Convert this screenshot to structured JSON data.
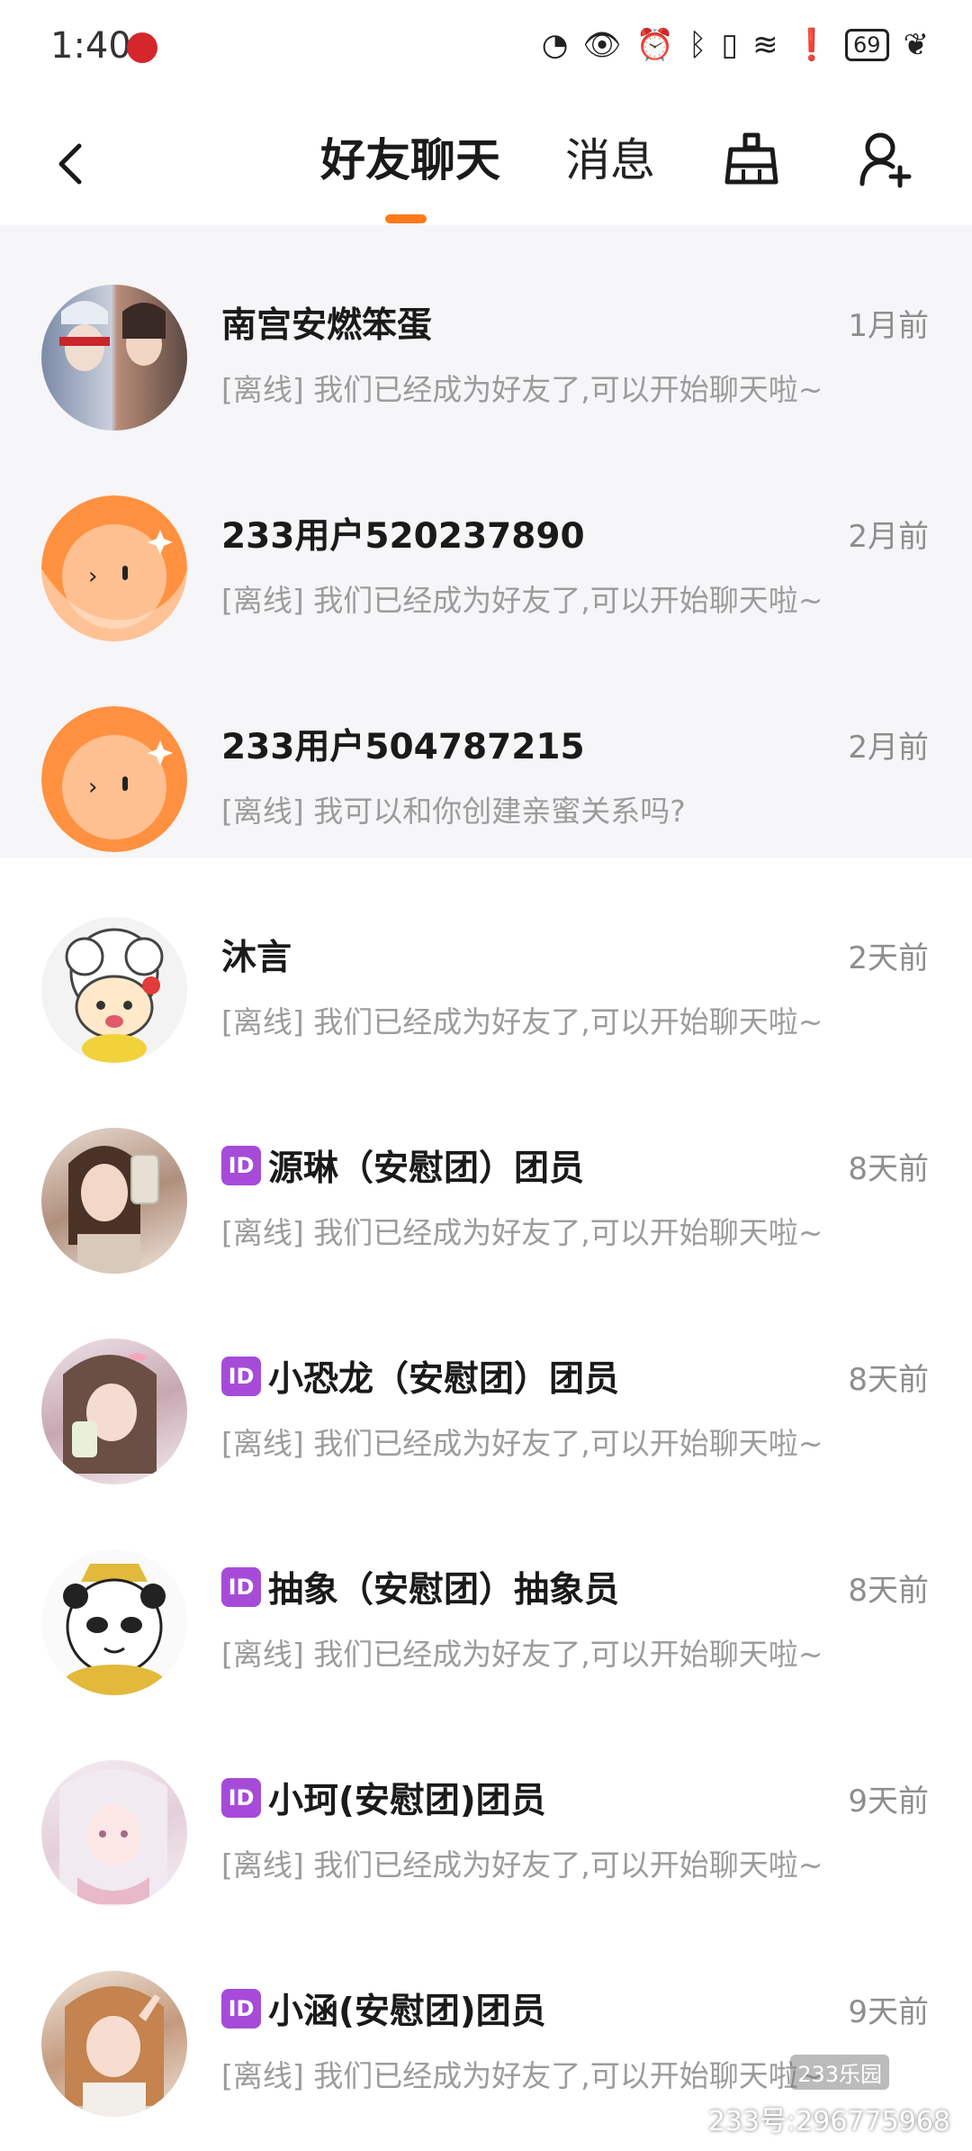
{
  "status_bar": {
    "time": "1:40",
    "battery": "69"
  },
  "header": {
    "tabs": [
      {
        "label": "好友聊天",
        "active": true
      },
      {
        "label": "消息",
        "active": false
      }
    ],
    "accent_color": "#ff7a1a"
  },
  "chats": [
    {
      "name": "南宫安燃笨蛋",
      "time": "1月前",
      "preview": "[离线] 我们已经成为好友了,可以开始聊天啦~",
      "badge": false
    },
    {
      "name": "233用户520237890",
      "time": "2月前",
      "preview": "[离线] 我们已经成为好友了,可以开始聊天啦~",
      "badge": false
    },
    {
      "name": "233用户504787215",
      "time": "2月前",
      "preview": "[离线] 我可以和你创建亲蜜关系吗?",
      "badge": false
    },
    {
      "name": "沐言",
      "time": "2天前",
      "preview": "[离线] 我们已经成为好友了,可以开始聊天啦~",
      "badge": false
    },
    {
      "name": "源琳（安慰团）团员",
      "time": "8天前",
      "preview": "[离线] 我们已经成为好友了,可以开始聊天啦~",
      "badge": true
    },
    {
      "name": "小恐龙（安慰团）团员",
      "time": "8天前",
      "preview": "[离线] 我们已经成为好友了,可以开始聊天啦~",
      "badge": true
    },
    {
      "name": "抽象（安慰团）抽象员",
      "time": "8天前",
      "preview": "[离线] 我们已经成为好友了,可以开始聊天啦~",
      "badge": true
    },
    {
      "name": "小珂(安慰团)团员",
      "time": "9天前",
      "preview": "[离线] 我们已经成为好友了,可以开始聊天啦~",
      "badge": true
    },
    {
      "name": "小涵(安慰团)团员",
      "time": "9天前",
      "preview": "[离线] 我们已经成为好友了,可以开始聊天啦~",
      "badge": true
    }
  ],
  "badge_text": "ID",
  "watermark": {
    "logo": "233乐园",
    "text": "233号:296775968"
  }
}
